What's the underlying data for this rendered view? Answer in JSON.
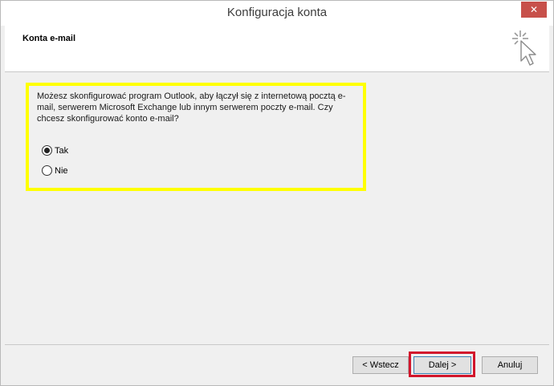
{
  "window": {
    "title": "Konfiguracja konta",
    "close_label": "✕"
  },
  "header": {
    "section_title": "Konta e-mail",
    "icon": "wizard-cursor-icon"
  },
  "content": {
    "prompt": "Możesz skonfigurować program Outlook, aby łączył się z internetową pocztą e-mail, serwerem Microsoft Exchange lub innym serwerem poczty e-mail. Czy chcesz skonfigurować konto e-mail?",
    "options": [
      {
        "label": "Tak",
        "selected": true
      },
      {
        "label": "Nie",
        "selected": false
      }
    ]
  },
  "footer": {
    "back_label": "< Wstecz",
    "next_label": "Dalej >",
    "cancel_label": "Anuluj"
  },
  "colors": {
    "highlight_yellow": "#ffff00",
    "highlight_red": "#d2162c",
    "close_red": "#c7504a"
  }
}
